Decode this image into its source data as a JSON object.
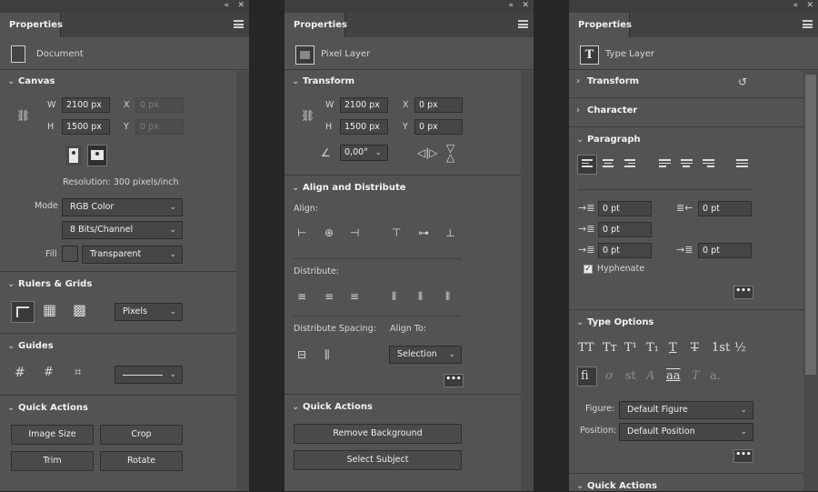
{
  "panels": [
    {
      "tab": "Properties",
      "kind": "Document",
      "canvas": {
        "title": "Canvas",
        "w_label": "W",
        "w_value": "2100 px",
        "h_label": "H",
        "h_value": "1500 px",
        "x_label": "X",
        "x_value": "0 px",
        "y_label": "Y",
        "y_value": "0 px",
        "resolution": "Resolution: 300 pixels/inch",
        "mode_label": "Mode",
        "mode_value": "RGB Color",
        "bits_value": "8 Bits/Channel",
        "fill_label": "Fill",
        "fill_value": "Transparent"
      },
      "rulers": {
        "title": "Rulers & Grids",
        "units": "Pixels"
      },
      "guides": {
        "title": "Guides"
      },
      "quick_actions": {
        "title": "Quick Actions",
        "buttons": [
          "Image Size",
          "Crop",
          "Trim",
          "Rotate"
        ]
      }
    },
    {
      "tab": "Properties",
      "kind": "Pixel Layer",
      "transform": {
        "title": "Transform",
        "w_label": "W",
        "w_value": "2100 px",
        "h_label": "H",
        "h_value": "1500 px",
        "x_label": "X",
        "x_value": "0 px",
        "y_label": "Y",
        "y_value": "0 px",
        "angle_value": "0,00°"
      },
      "align": {
        "title": "Align and Distribute",
        "align_label": "Align:",
        "distribute_label": "Distribute:",
        "spacing_label": "Distribute Spacing:",
        "align_to_label": "Align To:",
        "align_to_value": "Selection",
        "more": "•••"
      },
      "quick_actions": {
        "title": "Quick Actions",
        "buttons": [
          "Remove Background",
          "Select Subject"
        ]
      }
    },
    {
      "tab": "Properties",
      "kind": "Type Layer",
      "kind_glyph": "T",
      "sections": {
        "transform": "Transform",
        "character": "Character",
        "paragraph": "Paragraph"
      },
      "paragraph": {
        "indent_left": "0 pt",
        "indent_right": "0 pt",
        "indent_first": "0 pt",
        "space_before": "0 pt",
        "space_after": "0 pt",
        "hyphenate_label": "Hyphenate",
        "hyphenate_checked": true,
        "more": "•••"
      },
      "type_options": {
        "title": "Type Options",
        "glyphs": [
          "TT",
          "Tт",
          "T¹",
          "T₁",
          "T",
          "T",
          "1st",
          "½"
        ],
        "glyphs2": [
          "fi",
          "ơ",
          "st",
          "A",
          "aa",
          "T",
          "a."
        ],
        "figure_label": "Figure:",
        "figure_value": "Default Figure",
        "position_label": "Position:",
        "position_value": "Default Position",
        "more": "•••"
      },
      "quick_actions": {
        "title": "Quick Actions"
      }
    }
  ]
}
